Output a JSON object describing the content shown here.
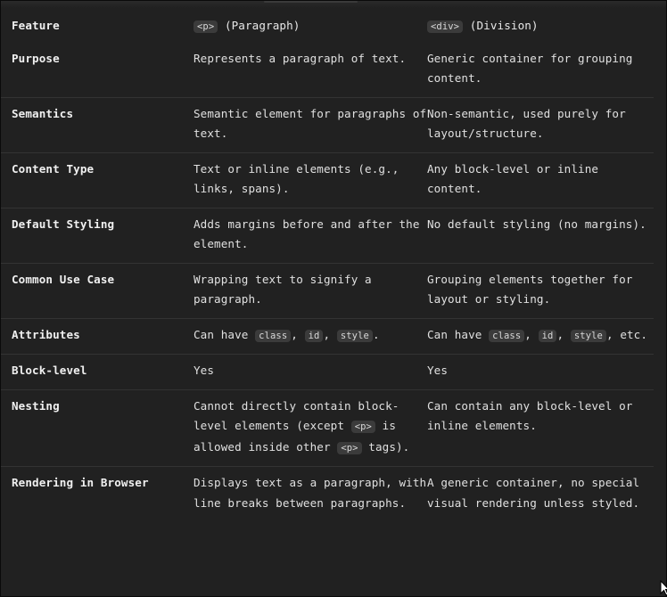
{
  "header": {
    "feature": "Feature",
    "col_p_tag": "<p>",
    "col_p_label": " (Paragraph)",
    "col_div_tag": "<div>",
    "col_div_label": " (Division)"
  },
  "rows": [
    {
      "feature": "Purpose",
      "p": "Represents a paragraph of text.",
      "div": "Generic container for grouping content."
    },
    {
      "feature": "Semantics",
      "p": "Semantic element for paragraphs of text.",
      "div": "Non-semantic, used purely for layout/structure."
    },
    {
      "feature": "Content Type",
      "p": "Text or inline elements (e.g., links, spans).",
      "div": "Any block-level or inline content."
    },
    {
      "feature": "Default Styling",
      "p": "Adds margins before and after the element.",
      "div": "No default styling (no margins)."
    },
    {
      "feature": "Common Use Case",
      "p": "Wrapping text to signify a paragraph.",
      "div": "Grouping elements together for layout or styling."
    },
    {
      "feature": "Attributes",
      "p_prefix": "Can have ",
      "p_code1": "class",
      "p_sep1": ", ",
      "p_code2": "id",
      "p_sep2": ", ",
      "p_code3": "style",
      "p_suffix": ".",
      "div_prefix": "Can have ",
      "div_code1": "class",
      "div_sep1": ", ",
      "div_code2": "id",
      "div_sep2": ", ",
      "div_code3": "style",
      "div_suffix": ", etc."
    },
    {
      "feature": "Block-level",
      "p": "Yes",
      "div": "Yes"
    },
    {
      "feature": "Nesting",
      "p_part1": "Cannot directly contain block-level elements (except ",
      "p_code1": "<p>",
      "p_part2": " is allowed inside other ",
      "p_code2": "<p>",
      "p_part3": " tags).",
      "div": "Can contain any block-level or inline elements."
    },
    {
      "feature": "Rendering in Browser",
      "p": "Displays text as a paragraph, with line breaks between paragraphs.",
      "div": "A generic container, no special visual rendering unless styled."
    }
  ]
}
